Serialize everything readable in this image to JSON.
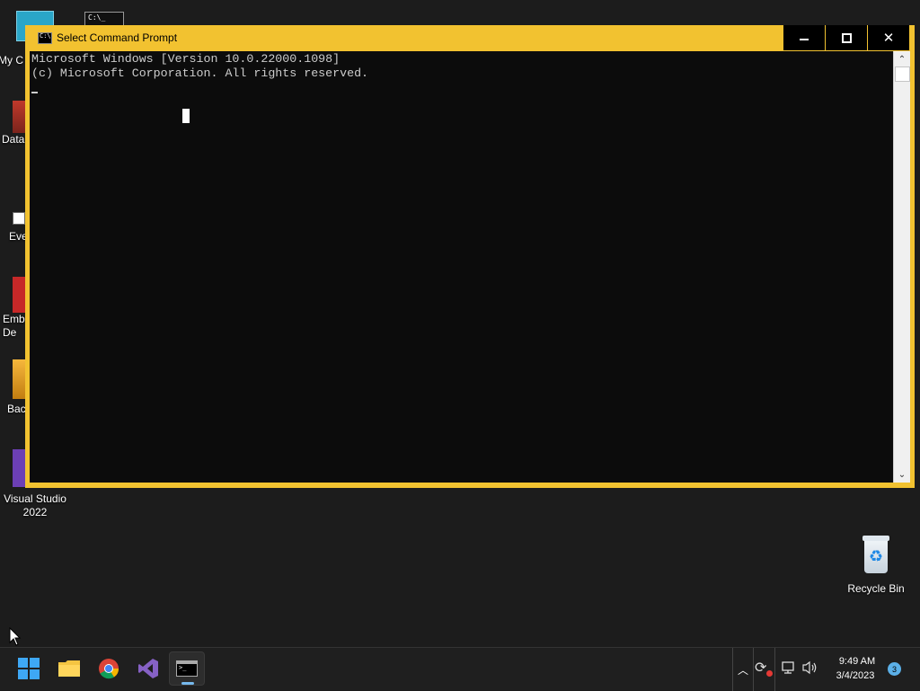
{
  "desktop": {
    "icons": [
      {
        "label": "My C"
      },
      {
        "label": "Data"
      },
      {
        "label": "Eve"
      },
      {
        "label": "Emb De"
      },
      {
        "label": "Bac"
      },
      {
        "label": "Visual Studio 2022"
      },
      {
        "label": "Recycle Bin"
      }
    ]
  },
  "window": {
    "title": "Select Command Prompt",
    "console_lines": [
      "Microsoft Windows [Version 10.0.22000.1098]",
      "(c) Microsoft Corporation. All rights reserved."
    ],
    "accent_color": "#f2c230"
  },
  "taskbar": {
    "apps": [
      "start-icon",
      "file-explorer-icon",
      "chrome-icon",
      "visual-studio-icon",
      "command-prompt-icon"
    ],
    "clock": {
      "time": "9:49 AM",
      "date": "3/4/2023"
    },
    "notification_count": "3"
  }
}
